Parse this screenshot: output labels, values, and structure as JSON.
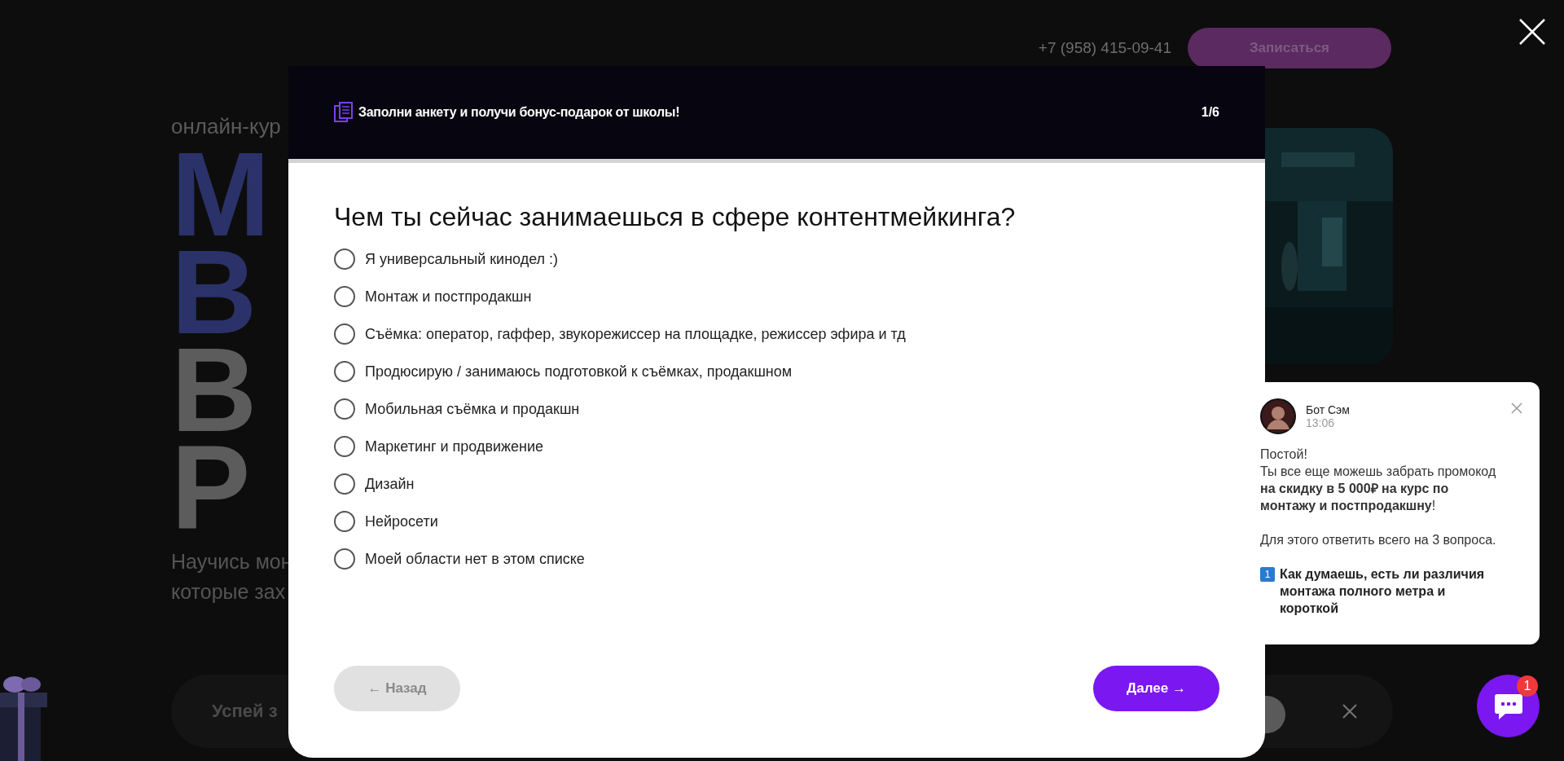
{
  "header": {
    "phone": "+7 (958) 415-09-41",
    "signup_button": "Записаться"
  },
  "hero": {
    "eyebrow": "онлайн-кур",
    "title_lines": [
      {
        "text": "М",
        "kind": "accent"
      },
      {
        "text": "В",
        "kind": "accent"
      },
      {
        "text": "В",
        "kind": "plain"
      },
      {
        "text": "P",
        "kind": "plain"
      }
    ],
    "subtitle_lines": [
      "Научись мон",
      "которые зах"
    ]
  },
  "promo_bar": {
    "text": "Успей з"
  },
  "survey": {
    "title": "Заполни анкету и получи бонус-подарок от школы!",
    "step": "1/6",
    "question": "Чем ты сейчас занимаешься в сфере контентмейкинга?",
    "options": [
      {
        "label": "Я универсальный кинодел :)",
        "selected": false
      },
      {
        "label": "Монтаж и постпродакшн",
        "selected": false
      },
      {
        "label": "Съёмка: оператор, гаффер, звукорежиссер на площадке, режиссер эфира и тд",
        "selected": false
      },
      {
        "label": "Продюсирую / занимаюсь подготовкой к съёмках, продакшном",
        "selected": false
      },
      {
        "label": "Мобильная съёмка и продакшн",
        "selected": false
      },
      {
        "label": "Маркетинг и продвижение",
        "selected": false
      },
      {
        "label": "Дизайн",
        "selected": false
      },
      {
        "label": "Нейросети",
        "selected": false
      },
      {
        "label": "Моей области нет в этом списке",
        "selected": false
      }
    ],
    "back_button": {
      "label": "← Назад",
      "disabled": true
    },
    "next_button": {
      "label": "Далее →",
      "disabled": false
    }
  },
  "chat_popup": {
    "sender": "Бот Сэм",
    "time": "13:06",
    "paragraphs": [
      "Постой!",
      "Ты все еще можешь забрать промокод **на скидку в 5 000₽ на курс по монтажу и постпродакшну**!",
      "Для этого ответить всего на 3 вопроса."
    ],
    "question_number": "1",
    "question": "Как думаешь, есть ли различия монтажа полного метра и короткой"
  },
  "chat_button": {
    "badge": "1"
  }
}
